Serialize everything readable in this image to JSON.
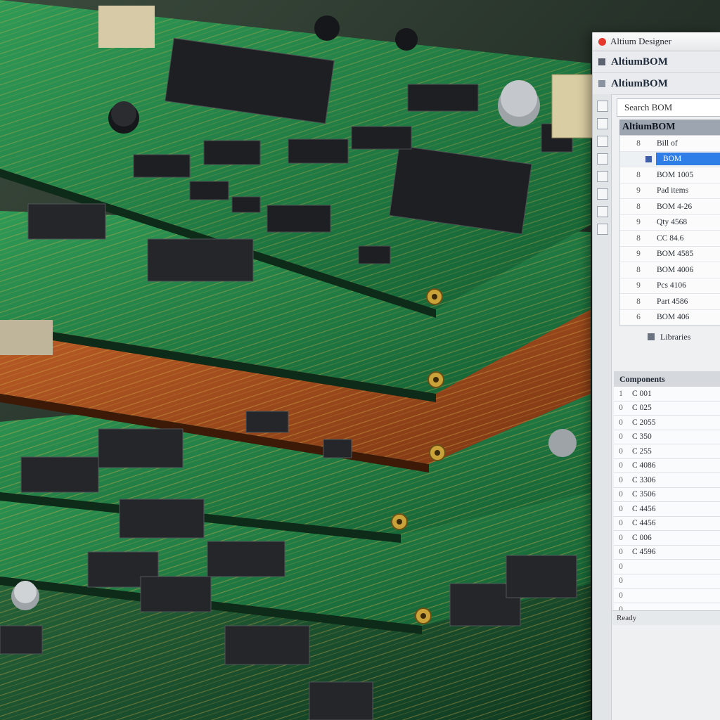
{
  "window": {
    "title": "Altium Designer",
    "app_icon_color": "#e23b2e"
  },
  "toolbar": {
    "row1": "AltiumBOM",
    "row2": "AltiumBOM"
  },
  "search": {
    "value": "Search BOM"
  },
  "bom_header": "AltiumBOM",
  "tree": {
    "rows": [
      {
        "num": "8",
        "label": "Bill of",
        "selected": false
      },
      {
        "num": "",
        "label": "BOM",
        "selected": true
      },
      {
        "num": "8",
        "label": "BOM 1005",
        "selected": false
      },
      {
        "num": "9",
        "label": "Pad items",
        "selected": false
      },
      {
        "num": "8",
        "label": "BOM 4-26",
        "selected": false
      },
      {
        "num": "9",
        "label": "Qty 4568",
        "selected": false
      },
      {
        "num": "8",
        "label": "CC 84.6",
        "selected": false
      },
      {
        "num": "9",
        "label": "BOM 4585",
        "selected": false
      },
      {
        "num": "8",
        "label": "BOM 4006",
        "selected": false
      },
      {
        "num": "9",
        "label": "Pcs 4106",
        "selected": false
      },
      {
        "num": "8",
        "label": "Part 4586",
        "selected": false
      },
      {
        "num": "6",
        "label": "BOM 406",
        "selected": false
      }
    ]
  },
  "group": {
    "label": "Libraries"
  },
  "list2": {
    "header": "Components",
    "rows": [
      {
        "num": "1",
        "label": "C 001"
      },
      {
        "num": "0",
        "label": "C 025"
      },
      {
        "num": "0",
        "label": "C 2055"
      },
      {
        "num": "0",
        "label": "C 350"
      },
      {
        "num": "0",
        "label": "C 255"
      },
      {
        "num": "0",
        "label": "C 4086"
      },
      {
        "num": "0",
        "label": "C 3306"
      },
      {
        "num": "0",
        "label": "C 3506"
      },
      {
        "num": "0",
        "label": "C 4456"
      },
      {
        "num": "0",
        "label": "C 4456"
      },
      {
        "num": "0",
        "label": "C 006"
      },
      {
        "num": "0",
        "label": "C 4596"
      },
      {
        "num": "0",
        "label": ""
      },
      {
        "num": "0",
        "label": ""
      },
      {
        "num": "0",
        "label": ""
      },
      {
        "num": "0",
        "label": ""
      }
    ]
  },
  "footer": "Ready",
  "colors": {
    "pcb_green": "#1f8a4a",
    "pcb_dark": "#16432a",
    "pcb_orange": "#b8521f",
    "trace_gold": "#c9a23a",
    "selection_blue": "#2f7ee8"
  },
  "scene": {
    "subject": "stacked circuit boards"
  }
}
